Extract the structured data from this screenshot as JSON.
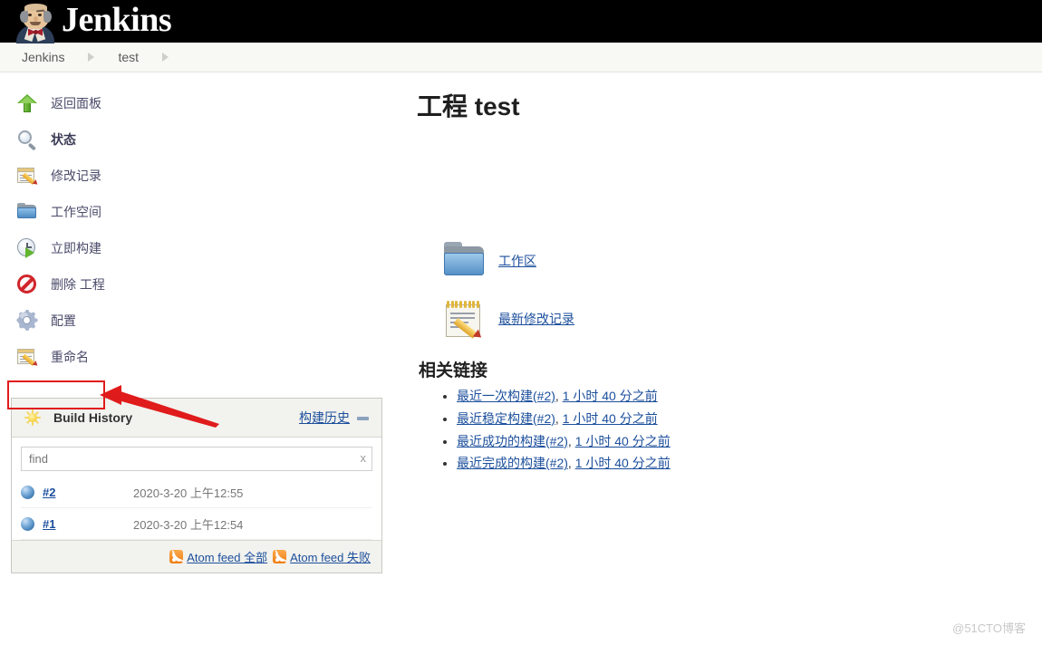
{
  "header": {
    "brand": "Jenkins",
    "logo_icon": "jenkins-butler-icon"
  },
  "breadcrumb": {
    "items": [
      {
        "label": "Jenkins"
      },
      {
        "label": "test"
      }
    ]
  },
  "sidebar": {
    "tasks": [
      {
        "label": "返回面板",
        "icon": "up-arrow-icon",
        "bold": false
      },
      {
        "label": "状态",
        "icon": "search-icon",
        "bold": true
      },
      {
        "label": "修改记录",
        "icon": "notepad-pencil-icon",
        "bold": false
      },
      {
        "label": "工作空间",
        "icon": "folder-icon",
        "bold": false
      },
      {
        "label": "立即构建",
        "icon": "build-clock-icon",
        "bold": false
      },
      {
        "label": "删除 工程",
        "icon": "delete-deny-icon",
        "bold": false
      },
      {
        "label": "配置",
        "icon": "gear-icon",
        "bold": false
      },
      {
        "label": "重命名",
        "icon": "notepad-pencil-icon",
        "bold": false
      }
    ],
    "highlight": {
      "target_label": "配置",
      "box_color": "#e01b1b",
      "arrow_color": "#e01b1b"
    }
  },
  "build_history": {
    "icon": "sun-icon",
    "title": "Build History",
    "cn_link": "构建历史",
    "collapse_icon": "minus-icon",
    "find": {
      "placeholder": "find",
      "value": "",
      "clear_label": "x"
    },
    "builds": [
      {
        "status_icon": "blue-ball-icon",
        "number": "#2",
        "time": "2020-3-20 上午12:55"
      },
      {
        "status_icon": "blue-ball-icon",
        "number": "#1",
        "time": "2020-3-20 上午12:54"
      }
    ],
    "feeds": [
      {
        "icon": "rss-icon",
        "label": "Atom feed 全部"
      },
      {
        "icon": "rss-icon",
        "label": "Atom feed 失败"
      }
    ]
  },
  "content": {
    "title": "工程 test",
    "jumplist": [
      {
        "icon": "folder-large-icon",
        "label": "工作区"
      },
      {
        "icon": "notepad-large-icon",
        "label": "最新修改记录"
      }
    ],
    "related": {
      "title": "相关链接",
      "links": [
        {
          "build": "最近一次构建(#2)",
          "sep": ", ",
          "age": "1 小时 40 分之前"
        },
        {
          "build": "最近稳定构建(#2)",
          "sep": ", ",
          "age": "1 小时 40 分之前"
        },
        {
          "build": "最近成功的构建(#2)",
          "sep": ", ",
          "age": "1 小时 40 分之前"
        },
        {
          "build": "最近完成的构建(#2)",
          "sep": ", ",
          "age": "1 小时 40 分之前"
        }
      ]
    }
  },
  "watermark": "@51CTO博客"
}
